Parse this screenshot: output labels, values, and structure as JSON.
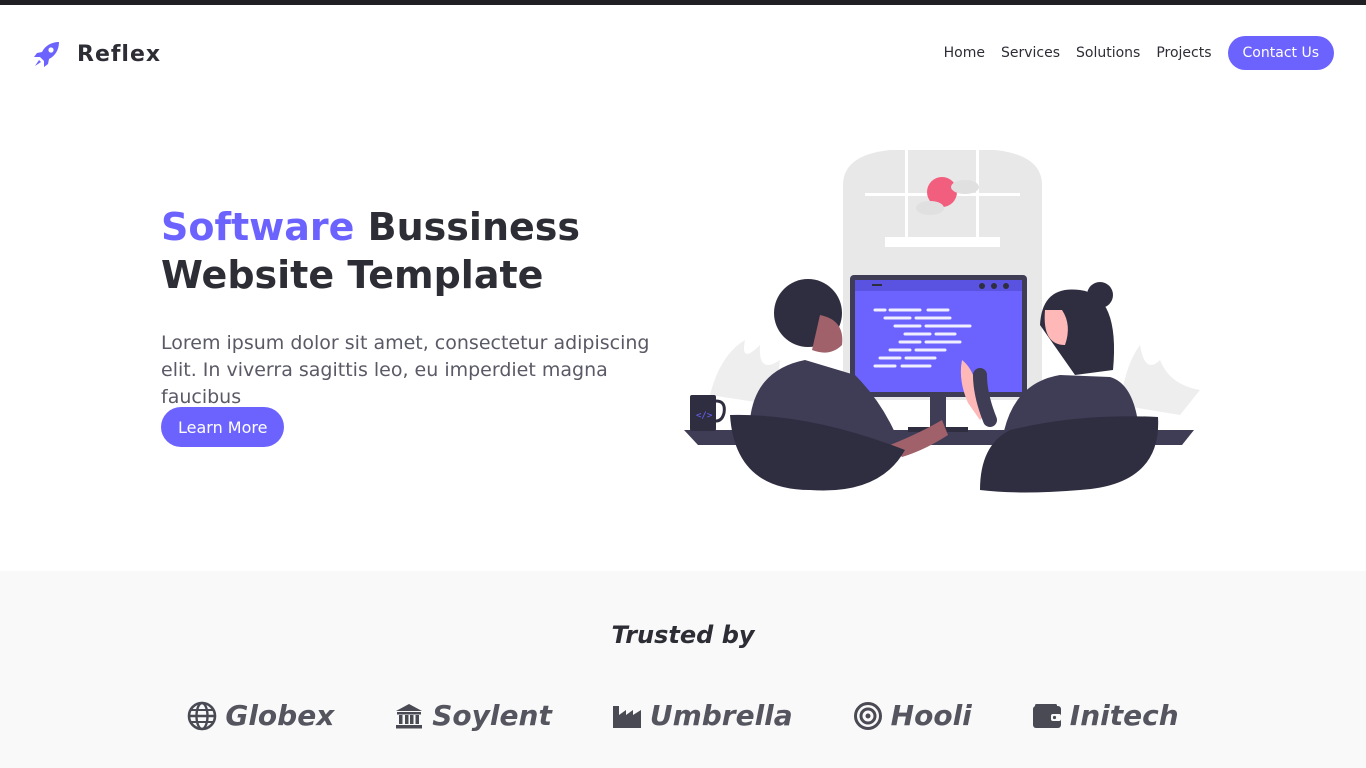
{
  "header": {
    "brand": "Reflex",
    "nav": [
      "Home",
      "Services",
      "Solutions",
      "Projects"
    ],
    "cta": "Contact Us"
  },
  "hero": {
    "title_accent": "Software",
    "title_rest_line1": " Bussiness",
    "title_line2": "Website Template",
    "text": "Lorem ipsum dolor sit amet, consectetur adipiscing elit. In viverra sagittis leo, eu imperdiet magna faucibus",
    "button": "Learn More"
  },
  "trusted": {
    "title": "Trusted by",
    "logos": [
      {
        "name": "Globex",
        "icon": "globe-icon"
      },
      {
        "name": "Soylent",
        "icon": "bank-icon"
      },
      {
        "name": "Umbrella",
        "icon": "factory-icon"
      },
      {
        "name": "Hooli",
        "icon": "target-icon"
      },
      {
        "name": "Initech",
        "icon": "wallet-icon"
      }
    ]
  },
  "colors": {
    "accent": "#6c63ff",
    "dark": "#2d2d35",
    "section_bg": "#f9f9f9"
  }
}
